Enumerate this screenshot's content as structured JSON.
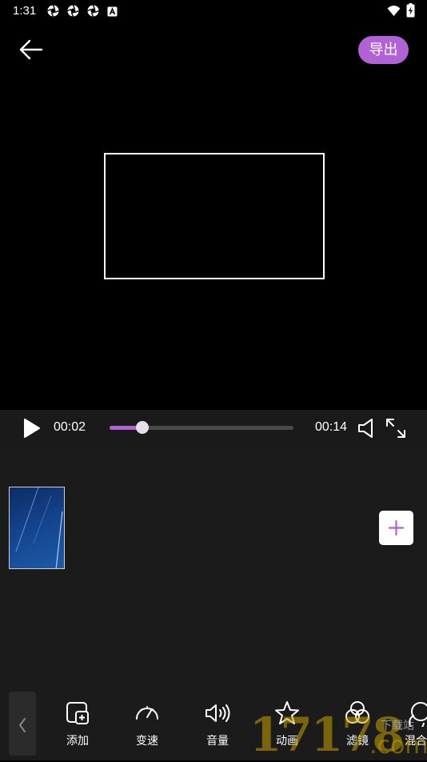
{
  "status_bar": {
    "time": "1:31",
    "icons": [
      "aperture-icon",
      "aperture-icon",
      "aperture-icon",
      "a-badge-icon",
      "wifi-icon",
      "battery-charging-icon"
    ]
  },
  "header": {
    "back_icon": "back-arrow-icon",
    "export_label": "导出"
  },
  "player": {
    "current_time": "00:02",
    "total_time": "00:14",
    "progress": 0.18
  },
  "timeline": {
    "clip_icon": "clip-thumbnail",
    "add_icon": "plus-icon"
  },
  "toolbar": {
    "tools": [
      {
        "label": "添加",
        "icon": "add-square-icon"
      },
      {
        "label": "变速",
        "icon": "speedometer-icon"
      },
      {
        "label": "音量",
        "icon": "volume-icon"
      },
      {
        "label": "动画",
        "icon": "star-icon"
      },
      {
        "label": "滤镜",
        "icon": "filter-circles-icon"
      },
      {
        "label": "混合",
        "icon": "blend-icon"
      }
    ]
  },
  "watermark": {
    "number": "17178",
    "cn_text": "下载站",
    "suffix": ".com"
  },
  "colors": {
    "accent": "#b062d6",
    "panel": "#1b1b1b",
    "background": "#000000"
  }
}
